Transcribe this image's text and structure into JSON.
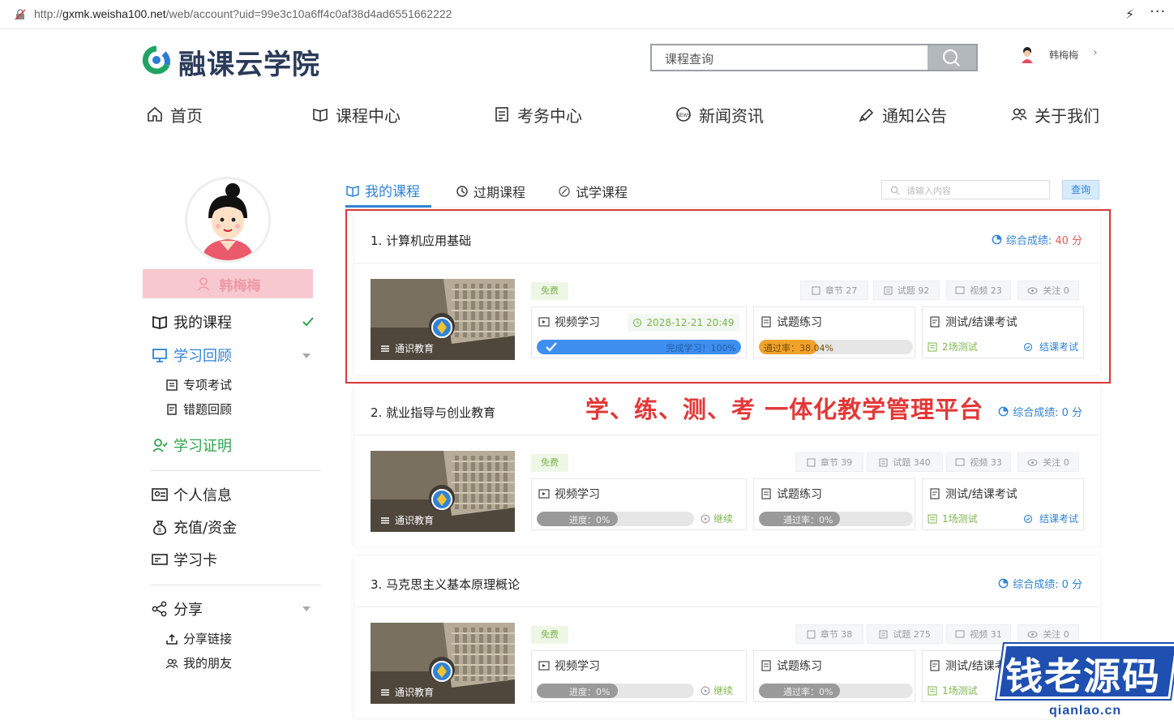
{
  "browser": {
    "url_prefix": "http://",
    "url_host": "gxmk.weisha100.net",
    "url_path": "/web/account?uid=99e3c10a6ff4c0af38d4ad6551662222"
  },
  "header": {
    "logo_text": "融课云学院",
    "search_placeholder": "课程查询",
    "username": "韩梅梅"
  },
  "nav": [
    {
      "label": "首页",
      "icon": "home-icon"
    },
    {
      "label": "课程中心",
      "icon": "book-icon"
    },
    {
      "label": "考务中心",
      "icon": "exam-icon"
    },
    {
      "label": "新闻资讯",
      "icon": "news-icon"
    },
    {
      "label": "通知公告",
      "icon": "notice-icon"
    },
    {
      "label": "关于我们",
      "icon": "people-icon"
    }
  ],
  "sidebar": {
    "name": "韩梅梅",
    "items": {
      "my_courses": "我的课程",
      "review": "学习回顾",
      "special_exam": "专项考试",
      "wrong_review": "错题回顾",
      "certificate": "学习证明",
      "profile": "个人信息",
      "recharge": "充值/资金",
      "study_card": "学习卡",
      "share": "分享",
      "share_link": "分享链接",
      "friends": "我的朋友"
    }
  },
  "tabs": {
    "my_courses": "我的课程",
    "expired": "过期课程",
    "trial": "试学课程",
    "search_placeholder": "请输入内容",
    "search_button": "查询"
  },
  "slogan": "学、练、测、考 一体化教学管理平台",
  "common": {
    "score_label": "综合成绩:",
    "free": "免费",
    "thumb_caption": "通识教育",
    "video_study": "视频学习",
    "practice": "试题练习",
    "exam": "测试/结课考试",
    "final_exam": "结课考试",
    "continue": "继续"
  },
  "courses": [
    {
      "title": "1. 计算机应用基础",
      "score": "40 分",
      "chapters": "章节 27",
      "questions": "试题 92",
      "videos": "视频 23",
      "follow": "关注 0",
      "date": "2028-12-21 20:49",
      "progress_label": "完成学习！100%",
      "progress": 1.0,
      "pass_label": "通过率：38.04%",
      "pass": 0.3804,
      "tests": "2场测试"
    },
    {
      "title": "2. 就业指导与创业教育",
      "score": "0 分",
      "chapters": "章节 39",
      "questions": "试题 340",
      "videos": "视频 33",
      "follow": "关注 0",
      "progress_label": "进度：0%",
      "progress": 0,
      "pass_label": "通过率：0%",
      "pass": 0,
      "tests": "1场测试"
    },
    {
      "title": "3. 马克思主义基本原理概论",
      "score": "0 分",
      "chapters": "章节 38",
      "questions": "试题 275",
      "videos": "视频 31",
      "follow": "关注 0",
      "progress_label": "进度：0%",
      "progress": 0,
      "pass_label": "通过率：0%",
      "pass": 0,
      "tests": "1场测试"
    }
  ],
  "watermark": {
    "title": "钱老源码",
    "sub": "qianlao.cn"
  },
  "colors": {
    "accent": "#2f83d8",
    "green": "#7bb54a",
    "red": "#d9383a",
    "progress_blue": "#3e8ef0",
    "pass_orange": "#f0a32b"
  }
}
